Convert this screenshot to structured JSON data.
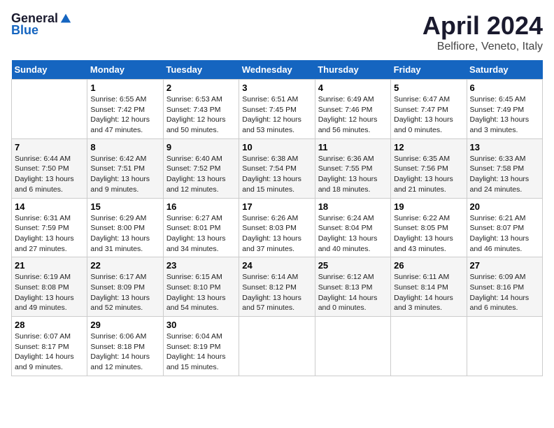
{
  "header": {
    "logo_general": "General",
    "logo_blue": "Blue",
    "month": "April 2024",
    "location": "Belfiore, Veneto, Italy"
  },
  "weekdays": [
    "Sunday",
    "Monday",
    "Tuesday",
    "Wednesday",
    "Thursday",
    "Friday",
    "Saturday"
  ],
  "weeks": [
    [
      {
        "day": "",
        "sunrise": "",
        "sunset": "",
        "daylight": ""
      },
      {
        "day": "1",
        "sunrise": "Sunrise: 6:55 AM",
        "sunset": "Sunset: 7:42 PM",
        "daylight": "Daylight: 12 hours and 47 minutes."
      },
      {
        "day": "2",
        "sunrise": "Sunrise: 6:53 AM",
        "sunset": "Sunset: 7:43 PM",
        "daylight": "Daylight: 12 hours and 50 minutes."
      },
      {
        "day": "3",
        "sunrise": "Sunrise: 6:51 AM",
        "sunset": "Sunset: 7:45 PM",
        "daylight": "Daylight: 12 hours and 53 minutes."
      },
      {
        "day": "4",
        "sunrise": "Sunrise: 6:49 AM",
        "sunset": "Sunset: 7:46 PM",
        "daylight": "Daylight: 12 hours and 56 minutes."
      },
      {
        "day": "5",
        "sunrise": "Sunrise: 6:47 AM",
        "sunset": "Sunset: 7:47 PM",
        "daylight": "Daylight: 13 hours and 0 minutes."
      },
      {
        "day": "6",
        "sunrise": "Sunrise: 6:45 AM",
        "sunset": "Sunset: 7:49 PM",
        "daylight": "Daylight: 13 hours and 3 minutes."
      }
    ],
    [
      {
        "day": "7",
        "sunrise": "Sunrise: 6:44 AM",
        "sunset": "Sunset: 7:50 PM",
        "daylight": "Daylight: 13 hours and 6 minutes."
      },
      {
        "day": "8",
        "sunrise": "Sunrise: 6:42 AM",
        "sunset": "Sunset: 7:51 PM",
        "daylight": "Daylight: 13 hours and 9 minutes."
      },
      {
        "day": "9",
        "sunrise": "Sunrise: 6:40 AM",
        "sunset": "Sunset: 7:52 PM",
        "daylight": "Daylight: 13 hours and 12 minutes."
      },
      {
        "day": "10",
        "sunrise": "Sunrise: 6:38 AM",
        "sunset": "Sunset: 7:54 PM",
        "daylight": "Daylight: 13 hours and 15 minutes."
      },
      {
        "day": "11",
        "sunrise": "Sunrise: 6:36 AM",
        "sunset": "Sunset: 7:55 PM",
        "daylight": "Daylight: 13 hours and 18 minutes."
      },
      {
        "day": "12",
        "sunrise": "Sunrise: 6:35 AM",
        "sunset": "Sunset: 7:56 PM",
        "daylight": "Daylight: 13 hours and 21 minutes."
      },
      {
        "day": "13",
        "sunrise": "Sunrise: 6:33 AM",
        "sunset": "Sunset: 7:58 PM",
        "daylight": "Daylight: 13 hours and 24 minutes."
      }
    ],
    [
      {
        "day": "14",
        "sunrise": "Sunrise: 6:31 AM",
        "sunset": "Sunset: 7:59 PM",
        "daylight": "Daylight: 13 hours and 27 minutes."
      },
      {
        "day": "15",
        "sunrise": "Sunrise: 6:29 AM",
        "sunset": "Sunset: 8:00 PM",
        "daylight": "Daylight: 13 hours and 31 minutes."
      },
      {
        "day": "16",
        "sunrise": "Sunrise: 6:27 AM",
        "sunset": "Sunset: 8:01 PM",
        "daylight": "Daylight: 13 hours and 34 minutes."
      },
      {
        "day": "17",
        "sunrise": "Sunrise: 6:26 AM",
        "sunset": "Sunset: 8:03 PM",
        "daylight": "Daylight: 13 hours and 37 minutes."
      },
      {
        "day": "18",
        "sunrise": "Sunrise: 6:24 AM",
        "sunset": "Sunset: 8:04 PM",
        "daylight": "Daylight: 13 hours and 40 minutes."
      },
      {
        "day": "19",
        "sunrise": "Sunrise: 6:22 AM",
        "sunset": "Sunset: 8:05 PM",
        "daylight": "Daylight: 13 hours and 43 minutes."
      },
      {
        "day": "20",
        "sunrise": "Sunrise: 6:21 AM",
        "sunset": "Sunset: 8:07 PM",
        "daylight": "Daylight: 13 hours and 46 minutes."
      }
    ],
    [
      {
        "day": "21",
        "sunrise": "Sunrise: 6:19 AM",
        "sunset": "Sunset: 8:08 PM",
        "daylight": "Daylight: 13 hours and 49 minutes."
      },
      {
        "day": "22",
        "sunrise": "Sunrise: 6:17 AM",
        "sunset": "Sunset: 8:09 PM",
        "daylight": "Daylight: 13 hours and 52 minutes."
      },
      {
        "day": "23",
        "sunrise": "Sunrise: 6:15 AM",
        "sunset": "Sunset: 8:10 PM",
        "daylight": "Daylight: 13 hours and 54 minutes."
      },
      {
        "day": "24",
        "sunrise": "Sunrise: 6:14 AM",
        "sunset": "Sunset: 8:12 PM",
        "daylight": "Daylight: 13 hours and 57 minutes."
      },
      {
        "day": "25",
        "sunrise": "Sunrise: 6:12 AM",
        "sunset": "Sunset: 8:13 PM",
        "daylight": "Daylight: 14 hours and 0 minutes."
      },
      {
        "day": "26",
        "sunrise": "Sunrise: 6:11 AM",
        "sunset": "Sunset: 8:14 PM",
        "daylight": "Daylight: 14 hours and 3 minutes."
      },
      {
        "day": "27",
        "sunrise": "Sunrise: 6:09 AM",
        "sunset": "Sunset: 8:16 PM",
        "daylight": "Daylight: 14 hours and 6 minutes."
      }
    ],
    [
      {
        "day": "28",
        "sunrise": "Sunrise: 6:07 AM",
        "sunset": "Sunset: 8:17 PM",
        "daylight": "Daylight: 14 hours and 9 minutes."
      },
      {
        "day": "29",
        "sunrise": "Sunrise: 6:06 AM",
        "sunset": "Sunset: 8:18 PM",
        "daylight": "Daylight: 14 hours and 12 minutes."
      },
      {
        "day": "30",
        "sunrise": "Sunrise: 6:04 AM",
        "sunset": "Sunset: 8:19 PM",
        "daylight": "Daylight: 14 hours and 15 minutes."
      },
      {
        "day": "",
        "sunrise": "",
        "sunset": "",
        "daylight": ""
      },
      {
        "day": "",
        "sunrise": "",
        "sunset": "",
        "daylight": ""
      },
      {
        "day": "",
        "sunrise": "",
        "sunset": "",
        "daylight": ""
      },
      {
        "day": "",
        "sunrise": "",
        "sunset": "",
        "daylight": ""
      }
    ]
  ]
}
